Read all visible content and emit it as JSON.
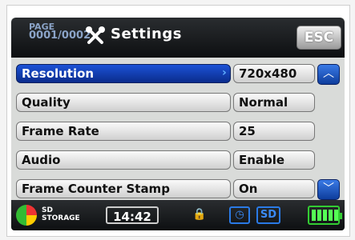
{
  "header": {
    "page_label": "PAGE",
    "page_number": "0001/0002",
    "title": "Settings",
    "esc_label": "ESC"
  },
  "settings": [
    {
      "label": "Resolution",
      "value": "720x480",
      "selected": true
    },
    {
      "label": "Quality",
      "value": "Normal",
      "selected": false
    },
    {
      "label": "Frame Rate",
      "value": "25",
      "selected": false
    },
    {
      "label": "Audio",
      "value": "Enable",
      "selected": false
    },
    {
      "label": "Frame Counter Stamp",
      "value": "On",
      "selected": false
    }
  ],
  "footer": {
    "storage_line1": "SD",
    "storage_line2": "STORAGE",
    "time": "14:42",
    "sd_badge": "SD"
  },
  "icons": {
    "title": "wrench-screwdriver-icon",
    "scroll_up": "chevron-up-icon",
    "scroll_down": "chevron-down-icon",
    "storage": "storage-pie-icon",
    "lock": "lock-icon",
    "timer": "clock-icon",
    "battery": "battery-icon"
  },
  "colors": {
    "selected_row": "#1c52d6",
    "header_bg": "#1a1c1e",
    "accent_blue": "#2a7ae6",
    "battery_green": "#55ff55"
  }
}
